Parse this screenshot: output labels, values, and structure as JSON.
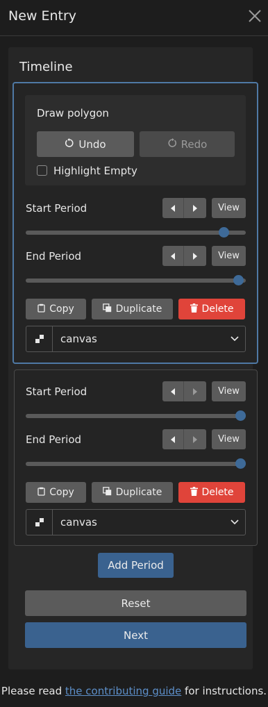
{
  "header": {
    "title": "New Entry",
    "close_icon": "close-icon"
  },
  "timeline": {
    "title": "Timeline"
  },
  "draw": {
    "title": "Draw polygon",
    "undo_label": "Undo",
    "redo_label": "Redo",
    "highlight_label": "Highlight Empty",
    "highlight_checked": false
  },
  "periods": [
    {
      "start_label": "Start Period",
      "end_label": "End Period",
      "view_label": "View",
      "start_value": 0.92,
      "end_value": 0.99,
      "copy_label": "Copy",
      "duplicate_label": "Duplicate",
      "delete_label": "Delete",
      "select_value": "canvas",
      "selected": true
    },
    {
      "start_label": "Start Period",
      "end_label": "End Period",
      "view_label": "View",
      "start_value": 1.0,
      "end_value": 1.0,
      "copy_label": "Copy",
      "duplicate_label": "Duplicate",
      "delete_label": "Delete",
      "select_value": "canvas",
      "selected": false
    }
  ],
  "actions": {
    "add_period": "Add Period",
    "reset": "Reset",
    "next": "Next"
  },
  "footer": {
    "prefix": "Please read ",
    "link_text": "the contributing guide",
    "suffix": " for instructions."
  },
  "colors": {
    "accent": "#3a628f",
    "danger": "#e0443a",
    "selected_border": "#4f79a5",
    "slider_thumb": "#3e6a98"
  }
}
